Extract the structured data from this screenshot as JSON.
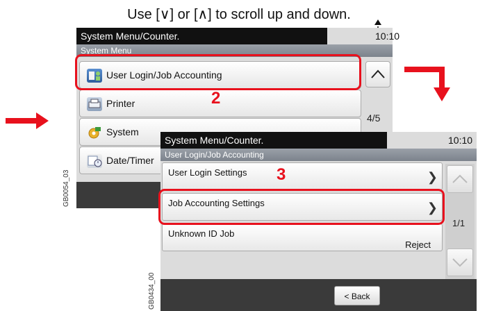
{
  "instruction": "Use [∨] or [∧] to scroll up and down.",
  "screen1": {
    "title": "System Menu/Counter.",
    "time": "10:10",
    "breadcrumb": "System Menu",
    "items": [
      {
        "label": "User Login/Job Accounting",
        "icon": "user-login-icon"
      },
      {
        "label": "Printer",
        "icon": "printer-icon"
      },
      {
        "label": "System",
        "icon": "system-icon"
      },
      {
        "label": "Date/Timer",
        "icon": "date-timer-icon"
      }
    ],
    "page_indicator": "4/5",
    "code": "GB0054_03"
  },
  "screen2": {
    "title": "System Menu/Counter.",
    "time": "10:10",
    "breadcrumb": "User Login/Job Accounting",
    "rows": [
      {
        "label": "User Login Settings"
      },
      {
        "label": "Job Accounting Settings"
      },
      {
        "label": "Unknown ID Job",
        "value": "Reject"
      }
    ],
    "page_indicator": "1/1",
    "back_label": "< Back",
    "code": "GB0434_00"
  },
  "steps": {
    "step2": "2",
    "step3": "3"
  },
  "colors": {
    "highlight": "#e8111d",
    "titlebar": "#111111",
    "panel": "#dcdcdc"
  }
}
